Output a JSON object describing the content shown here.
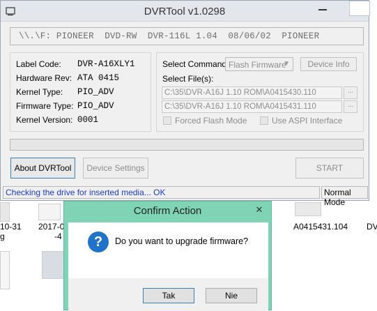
{
  "window": {
    "title": "DVRTool v1.0298",
    "drive_string": "\\\\.\\F: PIONEER  DVD-RW  DVR-116L 1.04  08/06/02  PIONEER"
  },
  "info": {
    "rows": [
      {
        "label": "Label Code:",
        "value": "DVR-A16XLY1"
      },
      {
        "label": "Hardware Rev:",
        "value": "ATA 0415"
      },
      {
        "label": "Kernel Type:",
        "value": "PIO_ADV"
      },
      {
        "label": "Firmware Type:",
        "value": "PIO_ADV"
      },
      {
        "label": "Kernel Version:",
        "value": "0001"
      }
    ]
  },
  "command": {
    "select_command_label": "Select Command:",
    "select_command_value": "Flash Firmware",
    "device_info_button": "Device Info",
    "select_files_label": "Select File(s):",
    "file1": "C:\\35\\DVR-A16J 1.10 ROM\\A0415430.110",
    "file2": "C:\\35\\DVR-A16J 1.10 ROM\\A0415431.110",
    "browse_label": "...",
    "forced_flash_label": "Forced Flash Mode",
    "use_aspi_label": "Use ASPI Interface"
  },
  "buttons": {
    "about": "About DVRTool",
    "device_settings": "Device Settings",
    "start": "START"
  },
  "status": {
    "message": "Checking the drive for inserted media... OK",
    "mode": "Normal Mode"
  },
  "desktop": {
    "item1": "10-31",
    "item1b": "g",
    "item2": "2017-0",
    "item2b": "-4",
    "item3": "A0415431.104",
    "item4": "DV"
  },
  "dialog": {
    "title": "Confirm Action",
    "message": "Do you want to upgrade firmware?",
    "yes": "Tak",
    "no": "Nie",
    "close": "✕"
  },
  "colors": {
    "dialog_frame": "#7ed4b4",
    "status_text": "#1a39c9",
    "question_icon": "#1f73c9"
  }
}
